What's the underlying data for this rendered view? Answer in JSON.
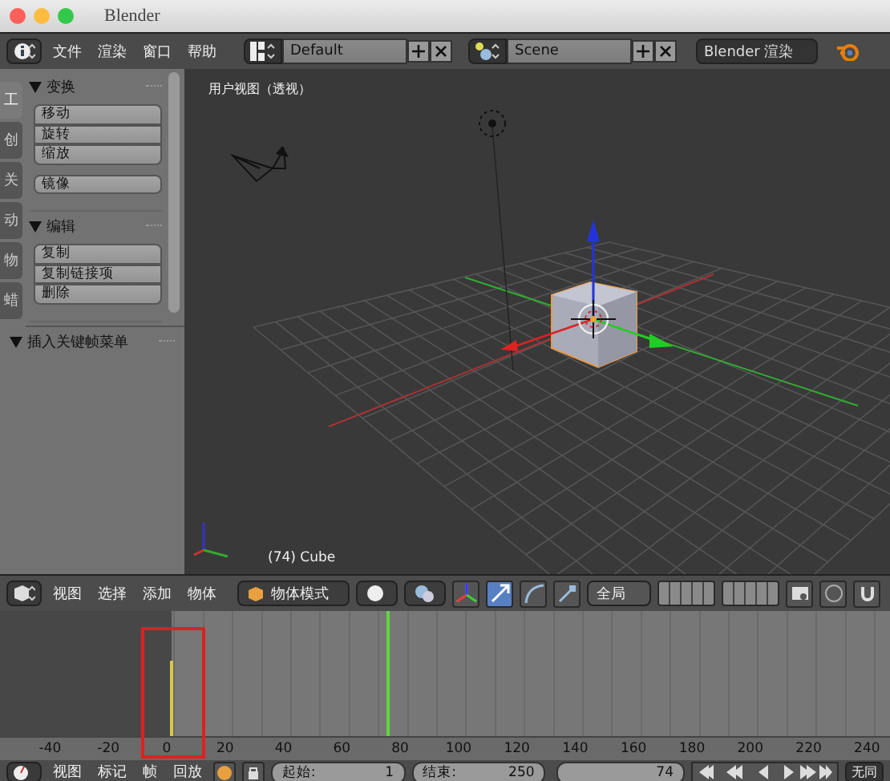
{
  "window": {
    "title": "Blender"
  },
  "menubar": {
    "menus": [
      "文件",
      "渲染",
      "窗口",
      "帮助"
    ],
    "layout": "Default",
    "scene": "Scene",
    "engine": "Blender 渲染"
  },
  "toolshelf": {
    "tabs": [
      {
        "label": "工",
        "selected": true
      },
      {
        "label": "创",
        "selected": false
      },
      {
        "label": "关",
        "selected": false
      },
      {
        "label": "动",
        "selected": false
      },
      {
        "label": "物",
        "selected": false
      },
      {
        "label": "蜡",
        "selected": false
      }
    ],
    "panels": [
      {
        "title": "变换",
        "expanded": true,
        "groups": [
          [
            "移动",
            "旋转",
            "缩放"
          ],
          [
            "镜像"
          ]
        ]
      },
      {
        "title": "编辑",
        "expanded": true,
        "groups": [
          [
            "复制",
            "复制链接项",
            "删除"
          ]
        ]
      }
    ],
    "footer": {
      "title": "插入关键帧菜单",
      "expanded": true
    }
  },
  "viewport": {
    "view_label": "用户视图（透视）",
    "object_label": "(74) Cube"
  },
  "view3d_header": {
    "menus": [
      "视图",
      "选择",
      "添加",
      "物体"
    ],
    "mode": "物体模式",
    "orientation": "全局"
  },
  "timeline": {
    "ticks": [
      "-40",
      "-20",
      "0",
      "20",
      "40",
      "60",
      "80",
      "100",
      "120",
      "140",
      "160",
      "180",
      "200",
      "220",
      "240"
    ],
    "menus": [
      "视图",
      "标记",
      "帧",
      "回放"
    ],
    "start": {
      "label": "起始:",
      "value": "1"
    },
    "end": {
      "label": "结束:",
      "value": "250"
    },
    "current": "74",
    "sync": "无同"
  }
}
